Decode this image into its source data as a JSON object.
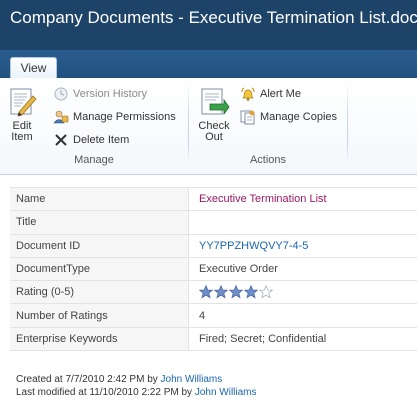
{
  "window": {
    "title": "Company Documents - Executive Termination List.docx"
  },
  "ribbon": {
    "tabs": [
      {
        "label": "View",
        "active": true
      }
    ],
    "groups": [
      {
        "label": "Manage",
        "buttons": {
          "edit_item": {
            "line1": "Edit",
            "line2": "Item",
            "icon": "edit-item-icon"
          },
          "version_history": {
            "label": "Version History",
            "icon": "version-history-icon",
            "enabled": false
          },
          "manage_permissions": {
            "label": "Manage Permissions",
            "icon": "permissions-icon",
            "enabled": true
          },
          "delete_item": {
            "label": "Delete Item",
            "icon": "delete-x-icon",
            "enabled": true
          }
        }
      },
      {
        "label": "Actions",
        "buttons": {
          "check_out": {
            "line1": "Check",
            "line2": "Out",
            "icon": "check-out-icon"
          },
          "alert_me": {
            "label": "Alert Me",
            "icon": "alert-bell-icon"
          },
          "manage_copies": {
            "label": "Manage Copies",
            "icon": "manage-copies-icon"
          }
        }
      }
    ]
  },
  "properties": [
    {
      "label": "Name",
      "value": "Executive Termination List",
      "style": "link-purple"
    },
    {
      "label": "Title",
      "value": ""
    },
    {
      "label": "Document ID",
      "value": "YY7PPZHWQVY7-4-5",
      "style": "link-blue"
    },
    {
      "label": "DocumentType",
      "value": "Executive Order"
    },
    {
      "label": "Rating (0-5)",
      "value": "",
      "rating": 4,
      "rating_max": 5
    },
    {
      "label": "Number of Ratings",
      "value": "4"
    },
    {
      "label": "Enterprise Keywords",
      "value": "Fired; Secret; Confidential"
    }
  ],
  "footer": {
    "created_prefix": "Created at 7/7/2010 2:42 PM by ",
    "created_by": "John Williams",
    "modified_prefix": "Last modified at 11/10/2010 2:22 PM by ",
    "modified_by": "John Williams"
  },
  "colors": {
    "titlebar": "#1d4468",
    "tabstrip": "#21517f",
    "link_purple": "#9a1867",
    "link_blue": "#1a66b0",
    "star_fill": "#6f8fc8"
  }
}
